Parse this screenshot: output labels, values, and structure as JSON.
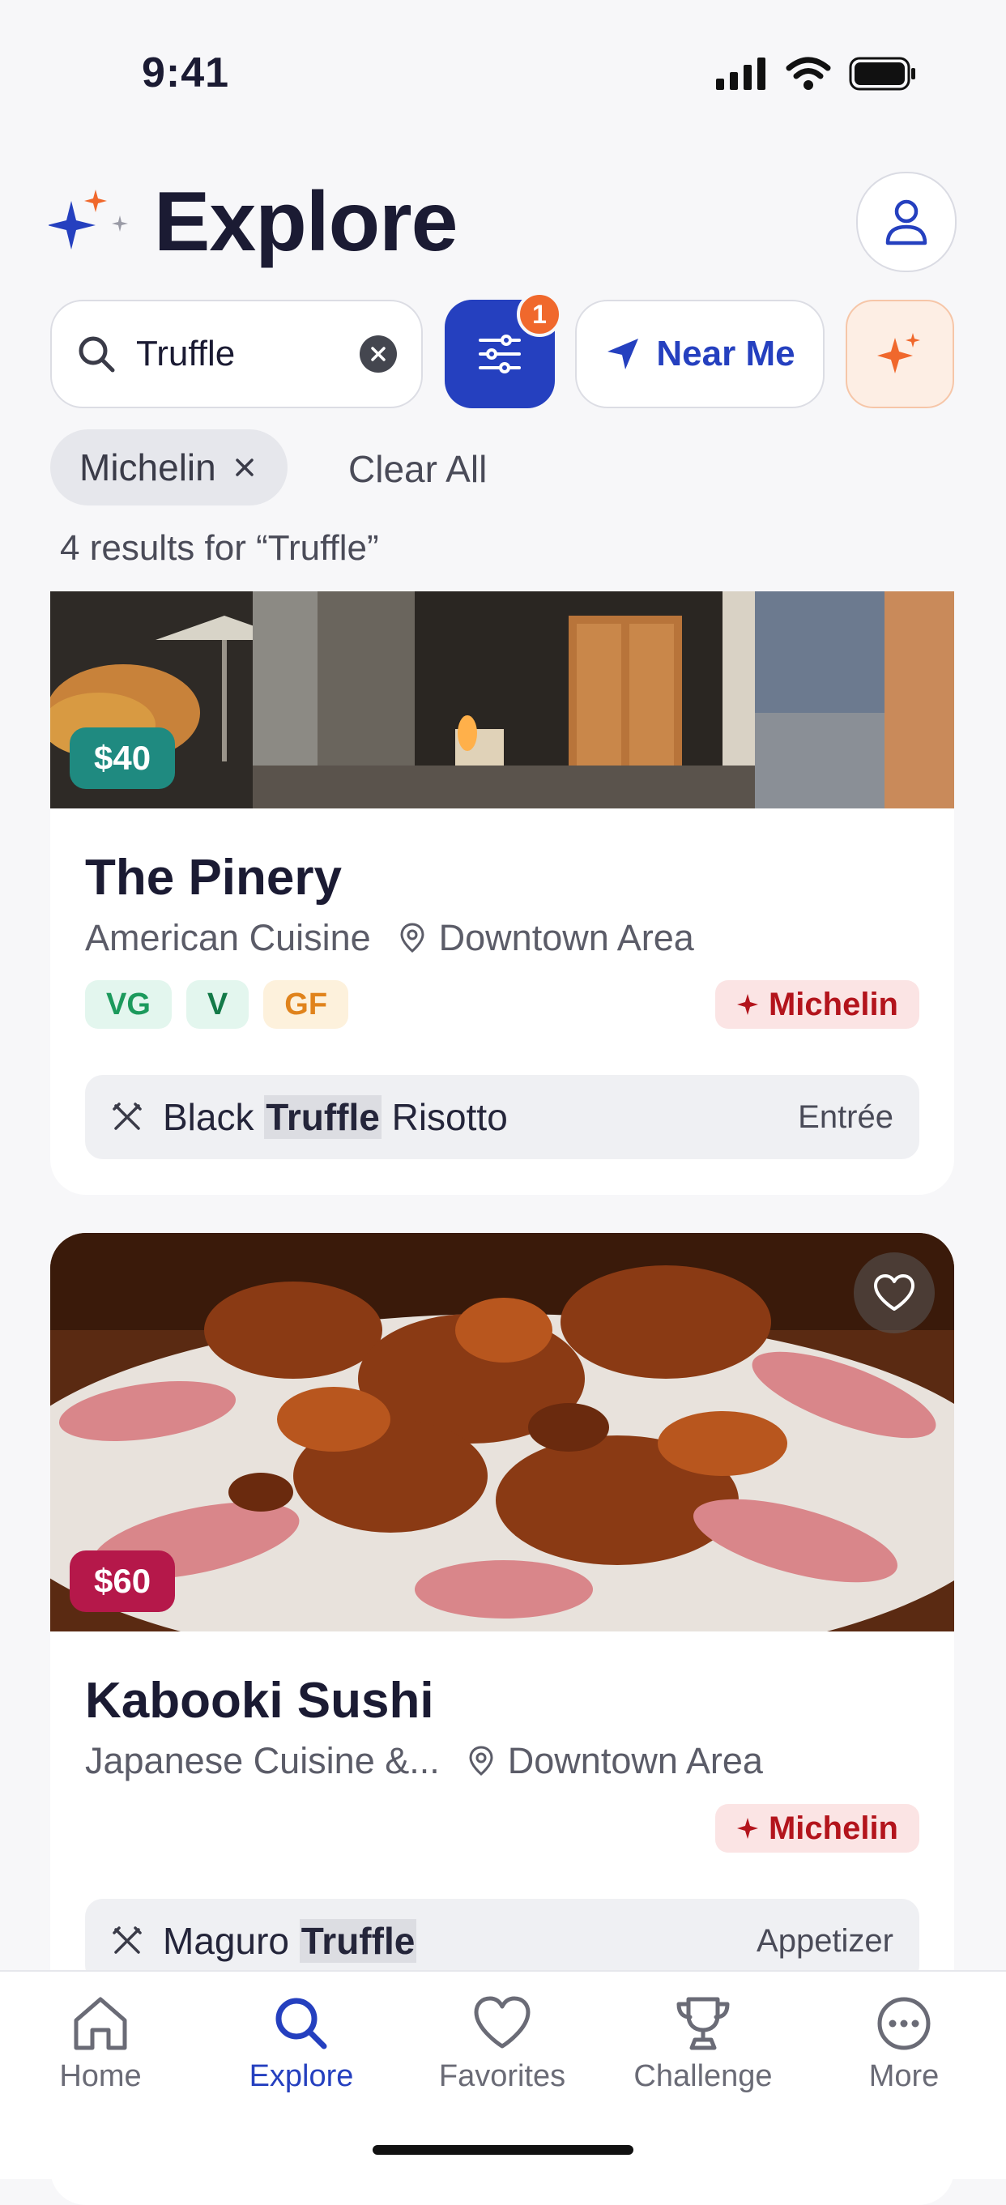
{
  "status_bar": {
    "time": "9:41"
  },
  "header": {
    "title": "Explore"
  },
  "search": {
    "value": "Truffle",
    "filter_count": "1",
    "near_me_label": "Near Me"
  },
  "filters": {
    "chips": [
      {
        "label": "Michelin"
      }
    ],
    "clear_all_label": "Clear All"
  },
  "results_text": "4 results for “Truffle”",
  "cards": [
    {
      "price": "$40",
      "price_color": "#1f8a80",
      "name": "The Pinery",
      "cuisine": "American Cuisine",
      "location": "Downtown Area",
      "diet_tags": [
        {
          "label": "VG"
        },
        {
          "label": "V"
        },
        {
          "label": "GF"
        }
      ],
      "badge": "Michelin",
      "dish": {
        "before": "Black ",
        "highlight": "Truffle",
        "after": " Risotto",
        "course": "Entrée"
      }
    },
    {
      "price": "$60",
      "price_color": "#b5184a",
      "name": "Kabooki Sushi",
      "cuisine": "Japanese Cuisine &...",
      "location": "Downtown Area",
      "badge": "Michelin",
      "dish": {
        "before": "Maguro ",
        "highlight": "Truffle",
        "after": "",
        "course": "Appetizer"
      }
    }
  ],
  "tabs": [
    {
      "label": "Home",
      "icon": "home-icon"
    },
    {
      "label": "Explore",
      "icon": "search-icon",
      "active": true
    },
    {
      "label": "Favorites",
      "icon": "heart-icon"
    },
    {
      "label": "Challenge",
      "icon": "trophy-icon"
    },
    {
      "label": "More",
      "icon": "more-icon"
    }
  ],
  "colors": {
    "accent": "#2540bf",
    "badge_orange": "#f0682c",
    "michelin_red": "#b3141c"
  }
}
